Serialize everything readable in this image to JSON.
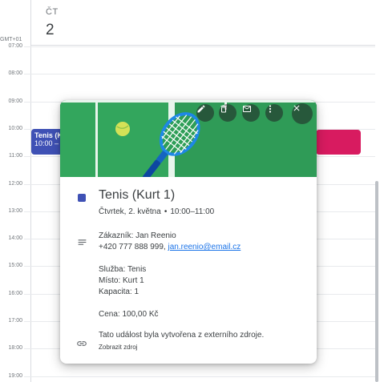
{
  "header": {
    "day_name": "ČT",
    "day_number": "2",
    "timezone": "GMT+01"
  },
  "hours": [
    "07:00",
    "08:00",
    "09:00",
    "10:00",
    "11:00",
    "12:00",
    "13:00",
    "14:00",
    "15:00",
    "16:00",
    "17:00",
    "18:00",
    "19:00"
  ],
  "calendar_events": [
    {
      "title": "Tenis (K",
      "time": "10:00 – 1",
      "color": "#3f51b5"
    },
    {
      "color": "#d81b60"
    }
  ],
  "popup": {
    "toolbar": {
      "edit_icon": "pencil-icon",
      "delete_icon": "trash-icon",
      "email_icon": "envelope-icon",
      "more_icon": "more-vert-icon",
      "close_icon": "close-icon"
    },
    "event_color": "#3f51b5",
    "title": "Tenis (Kurt 1)",
    "date": "Čtvrtek, 2. května",
    "separator": "•",
    "time_range": "10:00–11:00",
    "description": {
      "customer": "Zákazník: Jan Reenio",
      "phone": "+420 777 888 999, ",
      "email": "jan.reenio@email.cz",
      "service": "Služba: Tenis",
      "place": "Místo: Kurt 1",
      "capacity": "Kapacita: 1",
      "price": "Cena: 100,00 Kč"
    },
    "source": {
      "note": "Tato událost byla vytvořena z externího zdroje.",
      "link": "Zobrazit zdroj"
    }
  }
}
